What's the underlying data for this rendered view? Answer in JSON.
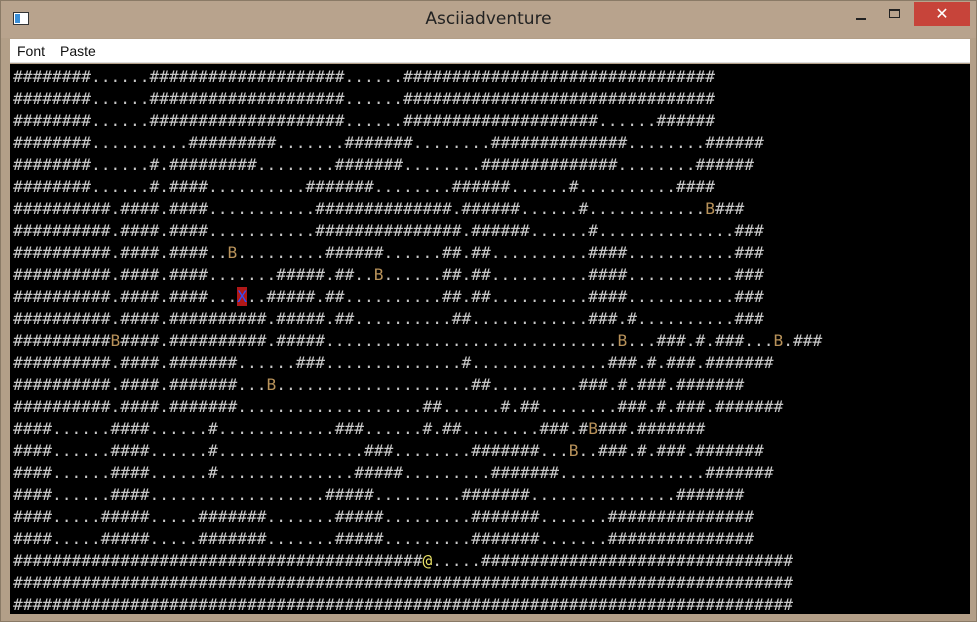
{
  "window": {
    "title": "Asciiadventure",
    "close_glyph": "✕"
  },
  "menu": [
    "Font",
    "Paste"
  ],
  "map": [
    "########......####################......################################",
    "########......####################......################################",
    "########......####################......####################......######",
    "########..........#########.......#######........##############........######",
    "########......#.#########........#######........##############........######",
    "########......#.####..........#######........######......#..........####",
    "##########.####.####...........##############.######......#............B###",
    "##########.####.####...........###############.######......#..............###",
    "##########.####.####..B.........######......##.##..........####...........###",
    "##########.####.####.......#####.##..B......##.##..........####...........###",
    "##########.####.####...X..#####.##..........##.##..........####...........###",
    "##########.####.##########.#####.##..........##............###.#..........###",
    "##########B####.##########.#####..............................B...###.#.###...B.###",
    "##########.####.#######......###..............#..............###.#.###.#######",
    "##########.####.#######...B....................##.........###.#.###.#######",
    "##########.####.#######...................##......#.##........###.#.###.#######",
    "####......####......#............###......#.##........###.#B###.#######",
    "####......####......#...............###........#######...B..###.#.###.#######",
    "####......####......#..............#####.........#######...............#######",
    "####......####..................#####.........#######...............#######",
    "####.....#####.....#######.......#####.........#######.......###############",
    "####.....#####.....#######.......#####.........#######.......###############",
    "##########################################@.....################################",
    "################################################################################",
    "################################################################################"
  ],
  "markers": {
    "player": "@",
    "monster": "B",
    "trap": "X"
  },
  "colors": {
    "wall": "#c8c8c8",
    "monster": "#b8925a",
    "player": "#e8e066",
    "trap_bg": "#b01818",
    "trap_fg": "#3050ff",
    "close_button": "#c7443a"
  }
}
